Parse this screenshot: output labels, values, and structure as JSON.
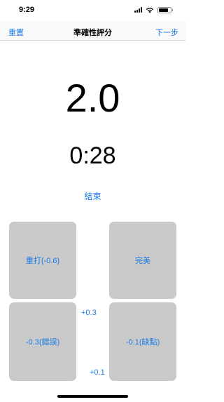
{
  "status_bar": {
    "time": "9:29",
    "signal_icon": "cellular-signal-icon",
    "wifi_icon": "wifi-icon",
    "battery_icon": "battery-icon",
    "battery_level": 0.8
  },
  "nav": {
    "left_label": "重置",
    "title": "準確性評分",
    "right_label": "下一步"
  },
  "score": "2.0",
  "timer": "0:28",
  "end_label": "結束",
  "buttons": {
    "reshoot": "重打(-0.6)",
    "perfect": "完美",
    "error": "-0.3(錯誤)",
    "flaw": "-0.1(缺點)",
    "plus_03": "+0.3",
    "plus_01": "+0.1"
  },
  "colors": {
    "accent": "#1a7be6",
    "tile": "#c9c9c9"
  }
}
